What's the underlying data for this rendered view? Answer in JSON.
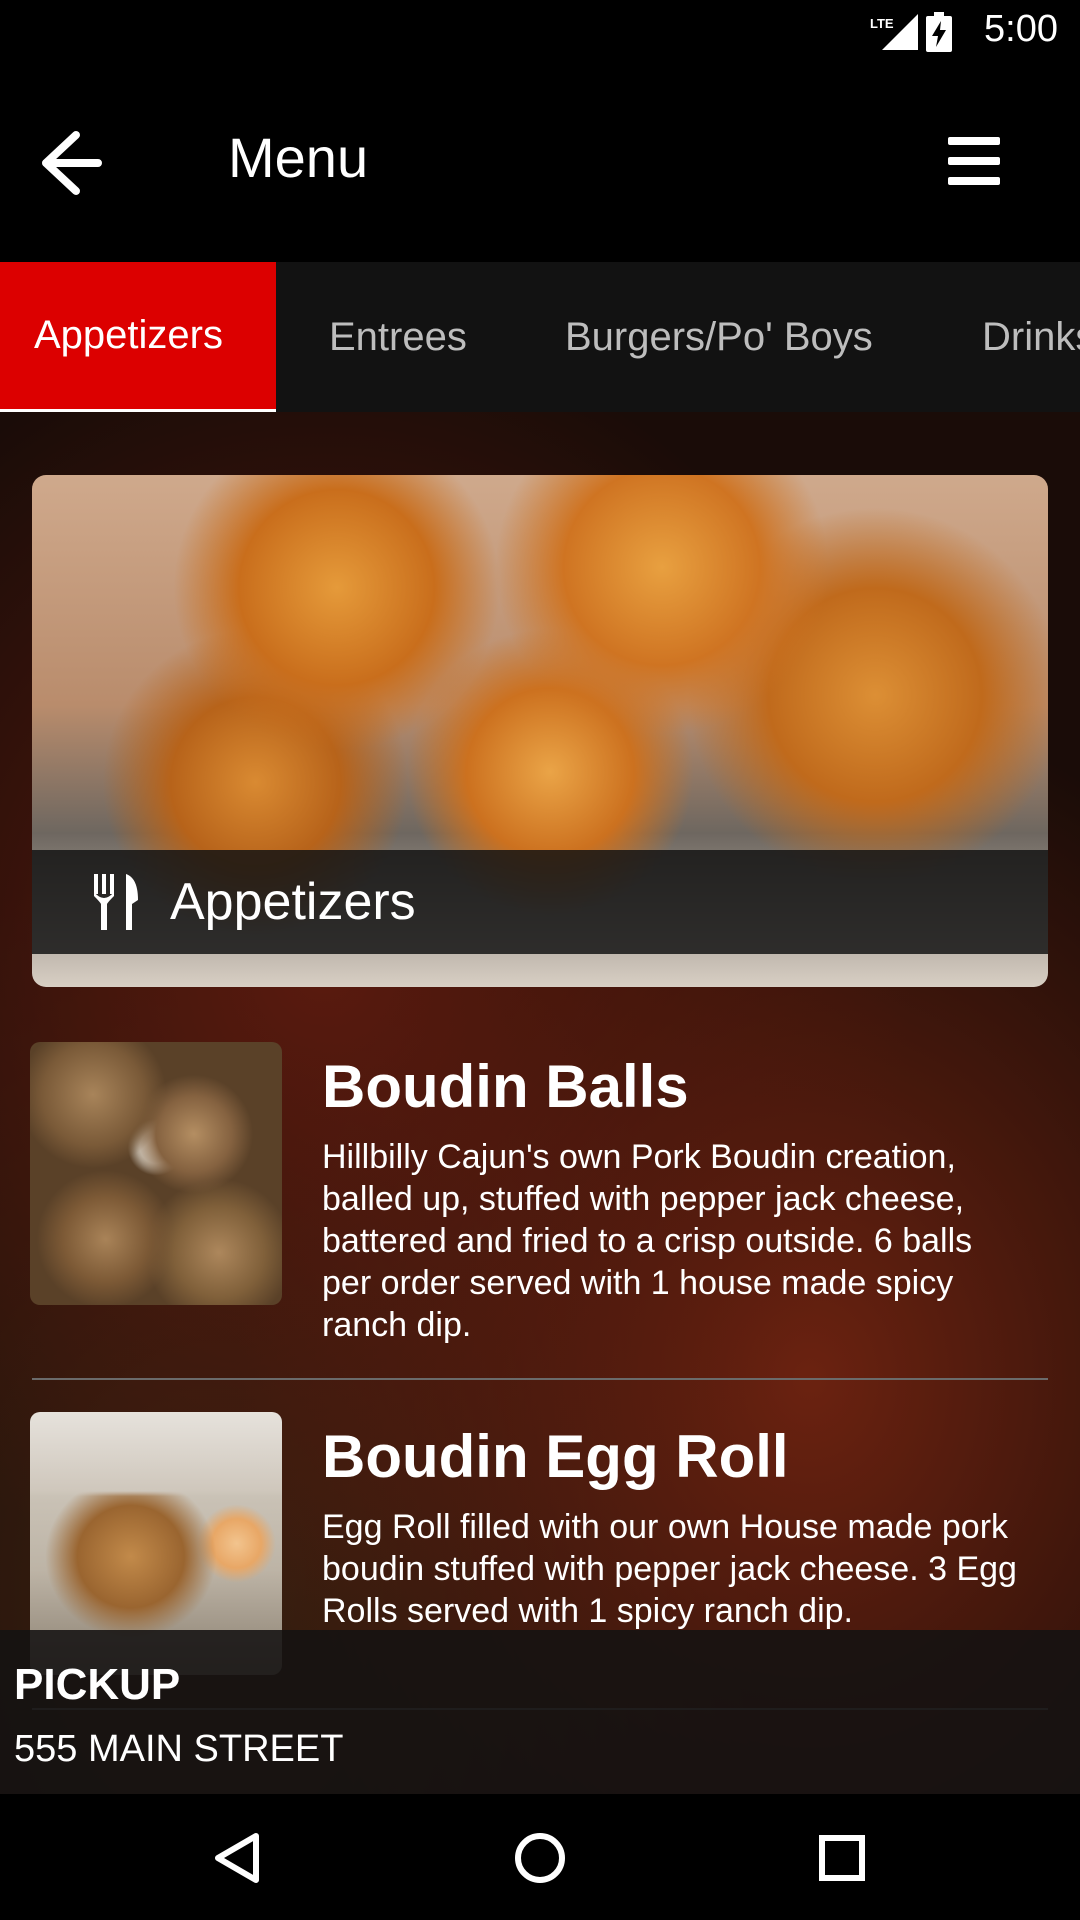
{
  "status_bar": {
    "time": "5:00",
    "network": "LTE"
  },
  "app_bar": {
    "title": "Menu",
    "back_icon": "arrow-left-icon",
    "menu_icon": "hamburger-menu-icon"
  },
  "tabs": [
    {
      "label": "Appetizers",
      "active": true
    },
    {
      "label": "Entrees",
      "active": false
    },
    {
      "label": "Burgers/Po' Boys",
      "active": false
    },
    {
      "label": "Drinks",
      "active": false
    }
  ],
  "category_banner": {
    "label": "Appetizers",
    "icon": "fork-knife-icon"
  },
  "items": [
    {
      "title": "Boudin Balls",
      "description": "Hillbilly Cajun's own Pork Boudin creation, balled up, stuffed with pepper jack cheese, battered and fried to a crisp outside. 6 balls per order served with 1 house made spicy ranch dip."
    },
    {
      "title": "Boudin Egg Roll",
      "description": "Egg Roll filled with our own House made pork boudin stuffed with pepper jack cheese. 3 Egg Rolls served with 1 spicy ranch dip."
    }
  ],
  "pickup": {
    "title": "PICKUP",
    "address": "555 MAIN STREET"
  },
  "colors": {
    "accent": "#dc0000",
    "app_bar": "#000000",
    "tabs_bg": "#121212"
  }
}
